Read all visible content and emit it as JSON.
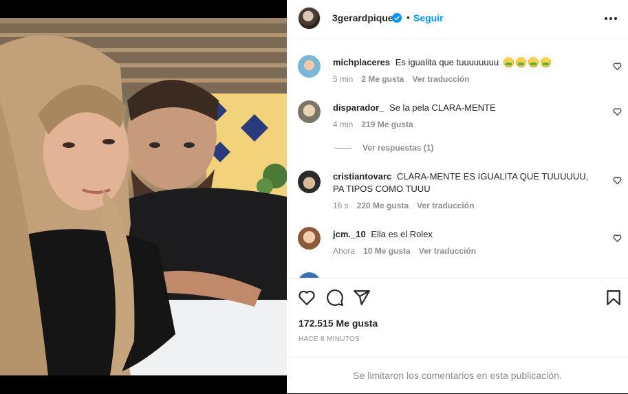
{
  "post": {
    "username": "3gerardpique",
    "separator": "•",
    "follow_label": "Seguir"
  },
  "comments": [
    {
      "user": "michplaceres",
      "text": "Es igualita que tuuuuuuuu",
      "emoji_count": 4,
      "time": "5 min",
      "likes": "2 Me gusta",
      "translate": "Ver traducción"
    },
    {
      "user": "disparador_",
      "text": "Se la pela CLARA-MENTE",
      "time": "4 min",
      "likes": "219 Me gusta",
      "replies": "Ver respuestas (1)"
    },
    {
      "user": "cristiantovarc",
      "text": "CLARA-MENTE ES IGUALITA QUE TUUUUUU, PA TIPOS COMO TUUU",
      "time": "16 s",
      "likes": "220 Me gusta",
      "translate": "Ver traducción"
    },
    {
      "user": "jcm._10",
      "text": "Ella es el Rolex",
      "time": "Ahora",
      "likes": "10 Me gusta",
      "translate": "Ver traducción"
    }
  ],
  "footer": {
    "likes": "172.515 Me gusta",
    "time_ago": "HACE 8 MINUTOS",
    "comments_limited": "Se limitaron los comentarios en esta publicación."
  },
  "colors": {
    "accent": "#0095f6",
    "muted": "#8e8e8e",
    "text": "#262626"
  },
  "icons": [
    "verified-badge-icon",
    "more-options-icon",
    "heart-icon",
    "comment-icon",
    "share-icon",
    "bookmark-icon"
  ]
}
